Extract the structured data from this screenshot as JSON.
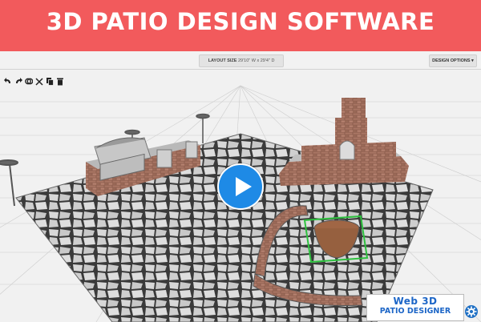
{
  "banner": {
    "title": "3D PATIO DESIGN SOFTWARE"
  },
  "toolbar": {
    "layout_label": "LAYOUT SIZE",
    "layout_value": "29'10\" W x 29'4\" D",
    "design_options": "DESIGN OPTIONS ▾"
  },
  "tools": [
    {
      "icon": "undo-icon"
    },
    {
      "icon": "redo-icon"
    },
    {
      "icon": "toggle-view-icon"
    },
    {
      "icon": "disconnect-icon"
    },
    {
      "icon": "copy-icon"
    },
    {
      "icon": "trash-icon"
    }
  ],
  "video": {
    "icon": "play-icon"
  },
  "badge": {
    "line1": "Web 3D",
    "line2": "PATIO DESIGNER"
  },
  "settings": {
    "icon": "gear-icon"
  },
  "colors": {
    "banner": "#f25a5c",
    "accent": "#1e8ae6",
    "brand_text": "#1d66c7"
  }
}
